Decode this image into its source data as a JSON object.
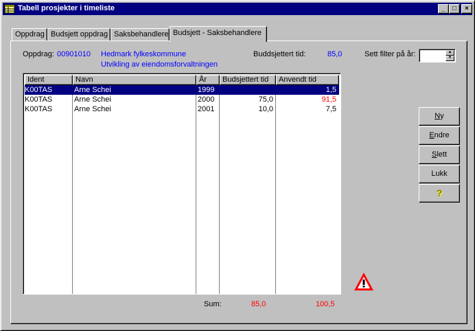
{
  "window": {
    "title": "Tabell prosjekter i timeliste"
  },
  "title_buttons": {
    "minimize": "_",
    "maximize": "□",
    "close": "×"
  },
  "tabs": [
    {
      "label": "Oppdrag"
    },
    {
      "label": "Budsjett oppdrag"
    },
    {
      "label": "Saksbehandlere"
    },
    {
      "label": "Budsjett - Saksbehandlere"
    }
  ],
  "info": {
    "oppdrag_label": "Oppdrag:",
    "oppdrag_value": "00901010",
    "client_line1": "Hedmark fylkeskommune",
    "client_line2": "Utvikling av eiendomsforvaltningen",
    "budget_label": "Buddsjettert tid:",
    "budget_value": "85,0",
    "filter_label": "Sett filter på år:",
    "filter_value": ""
  },
  "table": {
    "columns": [
      "Ident",
      "Navn",
      "År",
      "Budsjettert tid",
      "Anvendt tid"
    ],
    "rows": [
      {
        "ident": "K00TAS",
        "navn": "Arne Schei",
        "ar": "1999",
        "budsjettert": "",
        "anvendt": "1,5"
      },
      {
        "ident": "K00TAS",
        "navn": "Arne Schei",
        "ar": "2000",
        "budsjettert": "75,0",
        "anvendt": "91,5"
      },
      {
        "ident": "K00TAS",
        "navn": "Arne Schei",
        "ar": "2001",
        "budsjettert": "10,0",
        "anvendt": "7,5"
      }
    ]
  },
  "sum": {
    "label": "Sum:",
    "budsjettert": "85,0",
    "anvendt": "100,5"
  },
  "buttons": {
    "ny": {
      "accel": "N",
      "rest": "y"
    },
    "endre": {
      "accel": "E",
      "rest": "ndre"
    },
    "slett": {
      "accel": "S",
      "rest": "lett"
    },
    "lukk": "Lukk",
    "help": "?"
  },
  "colors": {
    "titlebar": "#000080",
    "link": "#0000ff",
    "overrun": "#ff0000",
    "selection": "#000080"
  },
  "icons": {
    "app": "table-icon",
    "warning": "warning-icon",
    "help": "question-icon"
  }
}
